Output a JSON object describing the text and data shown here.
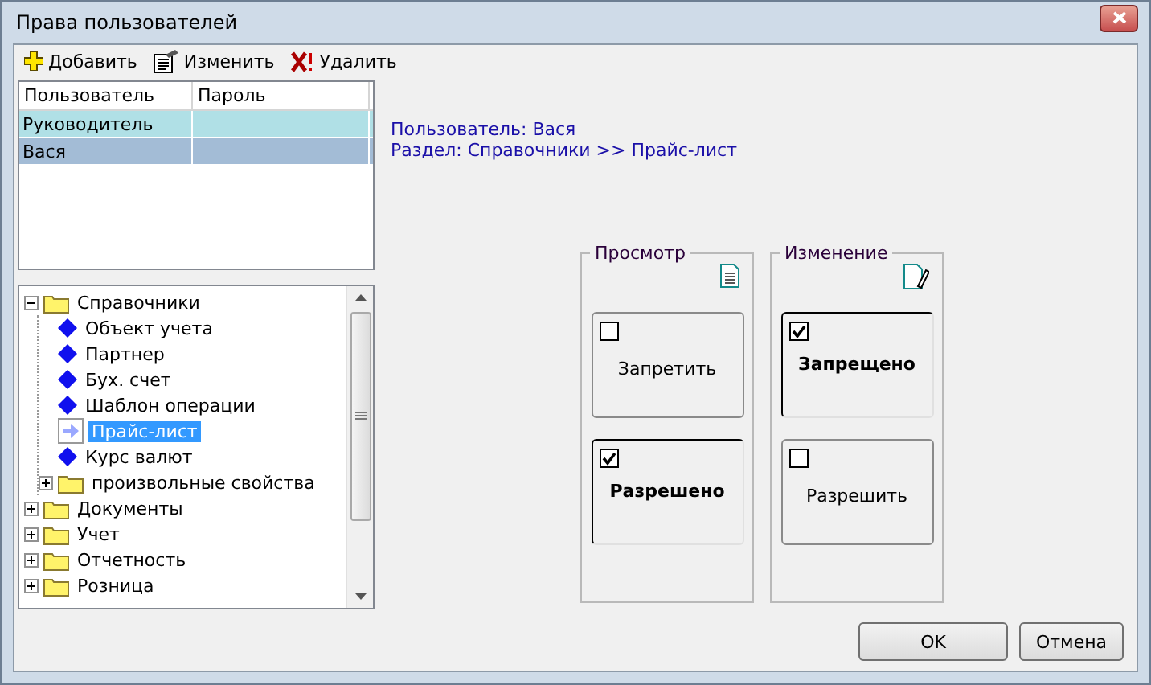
{
  "window": {
    "title": "Права пользователей"
  },
  "toolbar": [
    {
      "kind": "add",
      "label": "Добавить"
    },
    {
      "kind": "edit",
      "label": "Изменить"
    },
    {
      "kind": "delete",
      "label": "Удалить"
    }
  ],
  "users": {
    "columns": [
      "Пользователь",
      "Пароль"
    ],
    "rows": [
      {
        "name": "Руководитель",
        "selected": false
      },
      {
        "name": "Вася",
        "selected": true
      }
    ]
  },
  "tree": [
    {
      "kind": "folder",
      "label": "Справочники",
      "expanded": true,
      "selected": false,
      "children": [
        {
          "kind": "item",
          "label": "Объект учета",
          "selected": false
        },
        {
          "kind": "item",
          "label": "Партнер",
          "selected": false
        },
        {
          "kind": "item",
          "label": "Бух. счет",
          "selected": false
        },
        {
          "kind": "item",
          "label": "Шаблон операции",
          "selected": false
        },
        {
          "kind": "item",
          "label": "Прайс-лист",
          "selected": true
        },
        {
          "kind": "item",
          "label": "Курс валют",
          "selected": false
        },
        {
          "kind": "folder",
          "label": "произвольные свойства",
          "expanded": false,
          "selected": false
        }
      ]
    },
    {
      "kind": "folder",
      "label": "Документы",
      "expanded": false,
      "selected": false
    },
    {
      "kind": "folder",
      "label": "Учет",
      "expanded": false,
      "selected": false
    },
    {
      "kind": "folder",
      "label": "Отчетность",
      "expanded": false,
      "selected": false
    },
    {
      "kind": "folder",
      "label": "Розница",
      "expanded": false,
      "selected": false
    }
  ],
  "info": [
    "Пользователь:  Вася",
    "Раздел:  Справочники >> Прайс-лист"
  ],
  "permissions": [
    {
      "kind": "view",
      "title": "Просмотр",
      "options": [
        {
          "label": "Запретить",
          "checked": false
        },
        {
          "label": "Разрешено",
          "checked": true
        }
      ]
    },
    {
      "kind": "edit",
      "title": "Изменение",
      "options": [
        {
          "label": "Запрещено",
          "checked": true
        },
        {
          "label": "Разрешить",
          "checked": false
        }
      ]
    }
  ],
  "buttons": [
    "OK",
    "Отмена"
  ]
}
